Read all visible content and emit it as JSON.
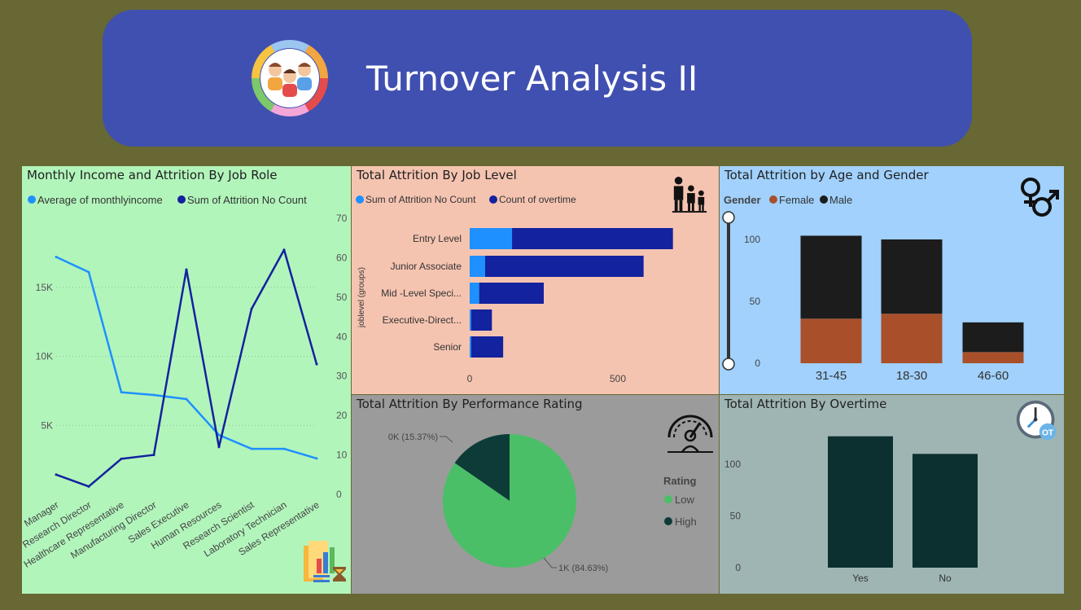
{
  "header": {
    "title": "Turnover Analysis II",
    "logo_icon": "people-group-icon"
  },
  "colors": {
    "background": "#676833",
    "banner": "#4050b0",
    "light_blue": "#1e90ff",
    "dark_blue": "#13229e",
    "female": "#a9502b",
    "male": "#1c1c1c",
    "low": "#4abf67",
    "high": "#0d3b38",
    "overtime_bar": "#0b302f"
  },
  "panels": {
    "income": {
      "title": "Monthly Income and Attrition By Job Role",
      "legend": [
        "Average of monthlyincome",
        "Sum of Attrition No Count"
      ],
      "icon": "bar-chart-hourglass-icon"
    },
    "job_level": {
      "title": "Total Attrition By Job Level",
      "legend": [
        "Sum of Attrition No Count",
        "Count of overtime"
      ],
      "ylabel": "joblevel (groups)",
      "icon": "family-icon"
    },
    "age_gender": {
      "title": "Total Attrition by Age and Gender",
      "legend_title": "Gender",
      "legend": [
        "Female",
        "Male"
      ],
      "icon": "gender-symbols-icon"
    },
    "performance": {
      "title": "Total Attrition By Performance Rating",
      "legend_title": "Rating",
      "legend": [
        "Low",
        "High"
      ],
      "icon": "performance-gauge-icon"
    },
    "overtime": {
      "title": "Total Attrition By Overtime",
      "icon": "overtime-clock-icon",
      "badge": "OT"
    }
  },
  "chart_data": [
    {
      "type": "line",
      "title": "Monthly Income and Attrition By Job Role",
      "categories": [
        "Manager",
        "Research Director",
        "Healthcare Representative",
        "Manufacturing Director",
        "Sales Executive",
        "Human Resources",
        "Research Scientist",
        "Laboratory Technician",
        "Sales Representative"
      ],
      "series": [
        {
          "name": "Average of monthlyincome",
          "axis": "left",
          "values": [
            17200,
            16100,
            7400,
            7200,
            6900,
            4300,
            3300,
            3300,
            2600
          ]
        },
        {
          "name": "Sum of Attrition No Count",
          "axis": "right",
          "values": [
            5,
            2,
            9,
            10,
            57,
            12,
            47,
            62,
            33
          ]
        }
      ],
      "y_left": {
        "ticks": [
          "5K",
          "10K",
          "15K"
        ],
        "tick_values": [
          5000,
          10000,
          15000
        ],
        "range": [
          0,
          20000
        ]
      },
      "y_right": {
        "ticks": [
          "0",
          "10",
          "20",
          "30",
          "40",
          "50",
          "60",
          "70"
        ],
        "tick_values": [
          0,
          10,
          20,
          30,
          40,
          50,
          60,
          70
        ],
        "range": [
          0,
          70
        ]
      }
    },
    {
      "type": "bar",
      "orientation": "horizontal",
      "stacked": true,
      "title": "Total Attrition By Job Level",
      "categories": [
        "Entry Level",
        "Junior Associate",
        "Mid -Level Speci...",
        "Executive-Direct...",
        "Senior"
      ],
      "series": [
        {
          "name": "Sum of Attrition No Count",
          "values": [
            143,
            52,
            32,
            5,
            5
          ]
        },
        {
          "name": "Count of overtime",
          "values": [
            543,
            535,
            218,
            70,
            108
          ]
        }
      ],
      "xlim": [
        0,
        720
      ],
      "x_ticks": [
        0,
        500
      ],
      "ylabel": "joblevel (groups)"
    },
    {
      "type": "bar",
      "stacked": true,
      "title": "Total Attrition by Age and Gender",
      "categories": [
        "31-45",
        "18-30",
        "46-60"
      ],
      "series": [
        {
          "name": "Female",
          "values": [
            36,
            40,
            9
          ]
        },
        {
          "name": "Male",
          "values": [
            67,
            60,
            24
          ]
        }
      ],
      "ylim": [
        0,
        110
      ],
      "y_ticks": [
        0,
        50,
        100
      ]
    },
    {
      "type": "pie",
      "title": "Total Attrition By Performance Rating",
      "slices": [
        {
          "name": "Low",
          "value": 84.63,
          "label": "1K (84.63%)"
        },
        {
          "name": "High",
          "value": 15.37,
          "label": "0K (15.37%)"
        }
      ]
    },
    {
      "type": "bar",
      "title": "Total Attrition By Overtime",
      "categories": [
        "Yes",
        "No"
      ],
      "values": [
        127,
        110
      ],
      "ylim": [
        0,
        140
      ],
      "y_ticks": [
        0,
        50,
        100
      ]
    }
  ]
}
